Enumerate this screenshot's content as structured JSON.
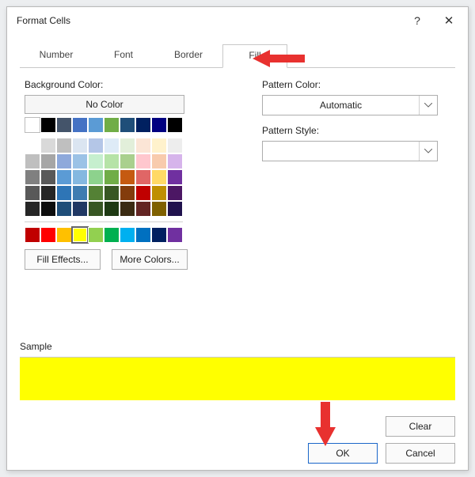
{
  "title": "Format Cells",
  "titlebar": {
    "help": "?",
    "close": "✕"
  },
  "tabs": {
    "number": "Number",
    "font": "Font",
    "border": "Border",
    "fill": "Fill"
  },
  "fill": {
    "bg_label": "Background Color:",
    "no_color": "No Color",
    "fill_effects": "Fill Effects...",
    "more_colors": "More Colors...",
    "palette_row1": [
      "#ffffff",
      "#000000",
      "#44546a",
      "#4472c4",
      "#5b9bd5",
      "#70ad47",
      "#1f4e79",
      "#002060",
      "#000080",
      "#000000"
    ],
    "palette_main": [
      [
        "#ffffff",
        "#d9d9d9",
        "#bfbfbf",
        "#dbe5f1",
        "#b4c6e7",
        "#deebf7",
        "#e2efda",
        "#fbe5d6",
        "#fff2cc",
        "#ededed"
      ],
      [
        "#bfbfbf",
        "#a6a6a6",
        "#8ea9db",
        "#9bc2e6",
        "#c6efce",
        "#b6e3a7",
        "#a9d08e",
        "#ffc7ce",
        "#f8cbad",
        "#d6b4eb"
      ],
      [
        "#808080",
        "#595959",
        "#5b9bd5",
        "#84b8e0",
        "#8dd28d",
        "#70ad47",
        "#c55a11",
        "#e06666",
        "#ffd966",
        "#7030a0"
      ],
      [
        "#595959",
        "#262626",
        "#2e75b6",
        "#3e7cb1",
        "#548135",
        "#385723",
        "#833c0c",
        "#c00000",
        "#bf8f00",
        "#4c1764"
      ],
      [
        "#262626",
        "#0d0d0d",
        "#1f4e79",
        "#203864",
        "#375623",
        "#1e3a13",
        "#3b2b13",
        "#632523",
        "#7f6000",
        "#20124d"
      ]
    ],
    "palette_standard": [
      "#c00000",
      "#ff0000",
      "#ffc000",
      "#ffff00",
      "#92d050",
      "#00b050",
      "#00b0f0",
      "#0070c0",
      "#002060",
      "#7030a0"
    ],
    "selected_color": "#ffff00"
  },
  "pattern": {
    "color_label": "Pattern Color:",
    "color_value": "Automatic",
    "style_label": "Pattern Style:"
  },
  "sample": {
    "label": "Sample"
  },
  "buttons": {
    "clear": "Clear",
    "ok": "OK",
    "cancel": "Cancel"
  }
}
